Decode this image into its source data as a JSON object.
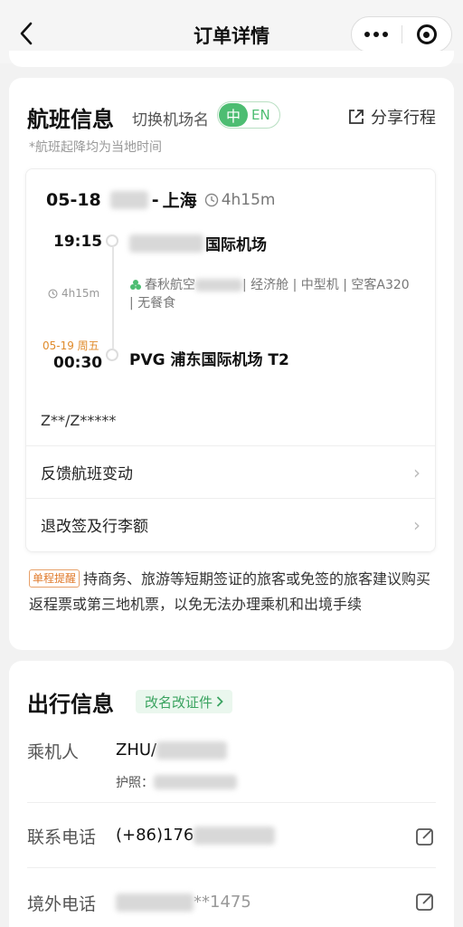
{
  "header": {
    "title": "订单详情"
  },
  "flight": {
    "section_title": "航班信息",
    "switch_label": "切换机场名",
    "lang_cn": "中",
    "lang_en": "EN",
    "share_label": "分享行程",
    "tz_note": "*航班起降均为当地时间",
    "route_date": "05-18",
    "route_dash": "-",
    "route_dest": "上海",
    "route_duration": "4h15m",
    "dep_time": "19:15",
    "dep_airport_suffix": "国际机场",
    "small_duration": "4h15m",
    "airline": "春秋航空",
    "info_rest": " | 经济舱 | 中型机 | 空客A320",
    "info_line2": "| 无餐食",
    "arr_date": "05-19 周五",
    "arr_time": "00:30",
    "arr_airport": "PVG 浦东国际机场 T2",
    "pnr": "Z**/Z*****",
    "row1": "反馈航班变动",
    "row2": "退改签及行李额",
    "tip_badge": "单程提醒",
    "tip_text": "持商务、旅游等短期签证的旅客或免签的旅客建议购买返程票或第三地机票，以免无法办理乘机和出境手续"
  },
  "travel": {
    "section_title": "出行信息",
    "rename_label": "改名改证件",
    "passenger_label": "乘机人",
    "passenger_value": "ZHU/",
    "passport_label": "护照：",
    "contact_label": "联系电话",
    "contact_value": "(+86)176",
    "overseas_label": "境外电话",
    "overseas_value": "**1475"
  },
  "colors": {
    "accent": "#4dbd72",
    "warning": "#e07a2b"
  }
}
